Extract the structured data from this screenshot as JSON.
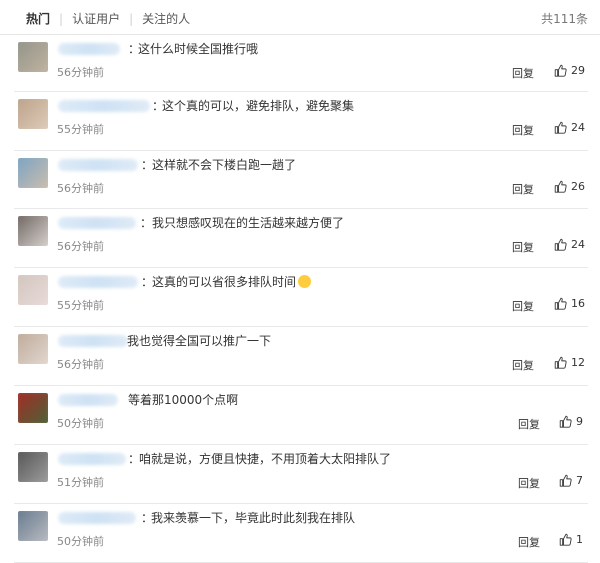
{
  "tabs": [
    {
      "label": "热门",
      "active": true
    },
    {
      "label": "认证用户",
      "active": false
    },
    {
      "label": "关注的人",
      "active": false
    }
  ],
  "total": "共111条",
  "reply_label": "回复",
  "comments": [
    {
      "text": "这什么时候全国推行哦",
      "time": "56分钟前",
      "likes": "29",
      "avatar_colors": [
        "#8a8f85",
        "#c9b8a5"
      ]
    },
    {
      "text": "这个真的可以，避免排队，避免聚集",
      "time": "55分钟前",
      "likes": "24",
      "avatar_colors": [
        "#b79b82",
        "#e3d3c1"
      ]
    },
    {
      "text": "这样就不会下楼白跑一趟了",
      "time": "56分钟前",
      "likes": "26",
      "avatar_colors": [
        "#6f9fc6",
        "#d8c2aa"
      ]
    },
    {
      "text": "我只想感叹现在的生活越来越方便了",
      "time": "56分钟前",
      "likes": "24",
      "avatar_colors": [
        "#5f5550",
        "#e8e3df"
      ]
    },
    {
      "text": "这真的可以省很多排队时间",
      "time": "55分钟前",
      "likes": "16",
      "avatar_colors": [
        "#cfc2b9",
        "#ecdedd"
      ]
    },
    {
      "text": "我也觉得全国可以推广一下",
      "time": "56分钟前",
      "likes": "12",
      "avatar_colors": [
        "#b8a393",
        "#e9dfd7"
      ]
    },
    {
      "text": "等着那10000个点啊",
      "time": "50分钟前",
      "likes": "9",
      "avatar_colors": [
        "#b22222",
        "#3d6c3b"
      ]
    },
    {
      "text": "咱就是说，方便且快捷，不用顶着大太阳排队了",
      "time": "51分钟前",
      "likes": "7",
      "avatar_colors": [
        "#4a4a4a",
        "#a9a9a9"
      ]
    },
    {
      "text": "我来羡慕一下，毕竟此时此刻我在排队",
      "time": "50分钟前",
      "likes": "1",
      "avatar_colors": [
        "#5a6f87",
        "#c7c7c9"
      ]
    }
  ]
}
